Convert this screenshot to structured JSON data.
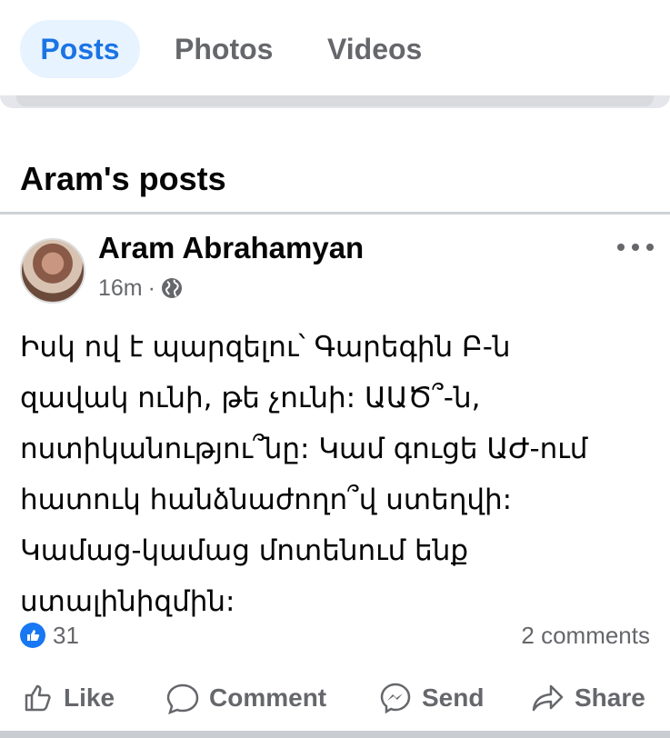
{
  "tabs": [
    {
      "label": "Posts",
      "active": true
    },
    {
      "label": "Photos",
      "active": false
    },
    {
      "label": "Videos",
      "active": false
    }
  ],
  "section": {
    "title": "Aram's posts"
  },
  "post": {
    "author": "Aram Abrahamyan",
    "time": "16m",
    "separator": "·",
    "audience_icon": "globe-icon",
    "text_lines": [
      "Իսկ ով է պարզելու՝ Գարեգին Բ-ն",
      "զավակ ունի, թե չունի: ԱԱԾ՞-ն,",
      "ոստիկանությու՞նը: Կամ գուցե ԱԺ-ում",
      "հատուկ հանձնաժողո՞վ ստեղվի:",
      "Կամաց-կամաց մոտենում ենք",
      "ստալինիզմին:"
    ],
    "reaction_count": "31",
    "comments": "2 comments"
  },
  "actions": {
    "like": "Like",
    "comment": "Comment",
    "send": "Send",
    "share": "Share"
  },
  "colors": {
    "accent": "#1b74e4",
    "active_tab_bg": "#e7f3ff",
    "secondary_text": "#65676b",
    "like_blue": "#1877f2"
  }
}
